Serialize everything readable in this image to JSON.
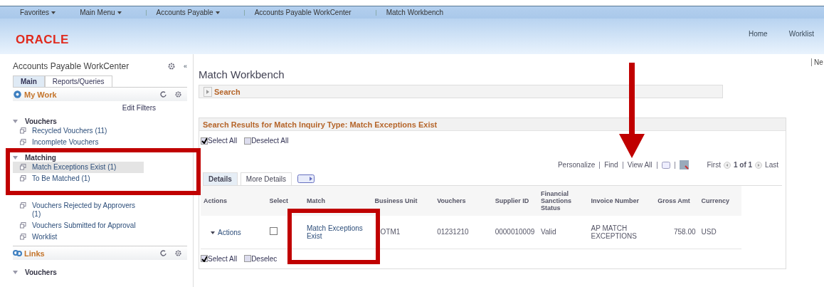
{
  "nav_bar": {
    "items": [
      {
        "label": "Favorites",
        "dropdown": true
      },
      {
        "label": "Main Menu",
        "dropdown": true
      },
      {
        "label": "Accounts Payable",
        "dropdown": true
      },
      {
        "label": "Accounts Payable WorkCenter",
        "dropdown": false
      },
      {
        "label": "Match Workbench",
        "dropdown": false
      }
    ]
  },
  "header": {
    "logo": "ORACLE",
    "links": [
      "Home",
      "Worklist"
    ],
    "edge_text": "Ne"
  },
  "sidebar": {
    "title": "Accounts Payable WorkCenter",
    "collapse": "«",
    "tabs": [
      {
        "label": "Main",
        "selected": true
      },
      {
        "label": "Reports/Queries",
        "selected": false
      }
    ],
    "sections": [
      {
        "title": "My Work",
        "action": "Edit Filters",
        "groups": [
          {
            "label": "Vouchers",
            "items": [
              {
                "label": "Recycled Vouchers (11)",
                "selected": false
              },
              {
                "label": "Incomplete Vouchers",
                "selected": false
              }
            ]
          },
          {
            "label": "Matching",
            "items": [
              {
                "label": "Match Exceptions Exist (1)",
                "selected": true
              },
              {
                "label": "To Be Matched (1)",
                "selected": false
              }
            ]
          },
          {
            "items": [
              {
                "label": "Vouchers Rejected by Approvers (1)",
                "selected": false
              },
              {
                "label": "Vouchers Submitted for Approval",
                "selected": false
              },
              {
                "label": "Worklist",
                "selected": false
              }
            ]
          }
        ]
      },
      {
        "title": "Links",
        "groups": [
          {
            "label": "Vouchers"
          }
        ]
      }
    ]
  },
  "main": {
    "title": "Match Workbench",
    "search_label": "Search",
    "results": {
      "title": "Search Results for Match Inquiry Type: Match Exceptions Exist",
      "top_checks": [
        {
          "label": "Select All",
          "checked": true
        },
        {
          "label": "Deselect All",
          "checked": false
        }
      ],
      "toolbar": [
        "Personalize",
        "Find",
        "View All"
      ],
      "pager": {
        "first": "First",
        "count": "1 of 1",
        "last": "Last"
      },
      "tabs": [
        {
          "label": "Details",
          "selected": true
        },
        {
          "label": "More Details",
          "selected": false
        }
      ],
      "columns": [
        "Actions",
        "Select",
        "Match",
        "Business Unit",
        "Vouchers",
        "Supplier ID",
        "Financial Sanctions Status",
        "Invoice Number",
        "Gross Amt",
        "Currency"
      ],
      "rows": [
        {
          "actions": "Actions",
          "checked": false,
          "match": "Match Exceptions Exist",
          "business_unit": "OTM1",
          "vouchers": "01231210",
          "supplier_id": "0000010009",
          "status": "Valid",
          "invoice": "AP MATCH EXCEPTIONS",
          "gross": "758.00",
          "currency": "USD"
        }
      ],
      "bottom_checks": [
        {
          "label": "Select All",
          "checked": true
        },
        {
          "label": "Deselec",
          "checked": false
        }
      ]
    }
  }
}
